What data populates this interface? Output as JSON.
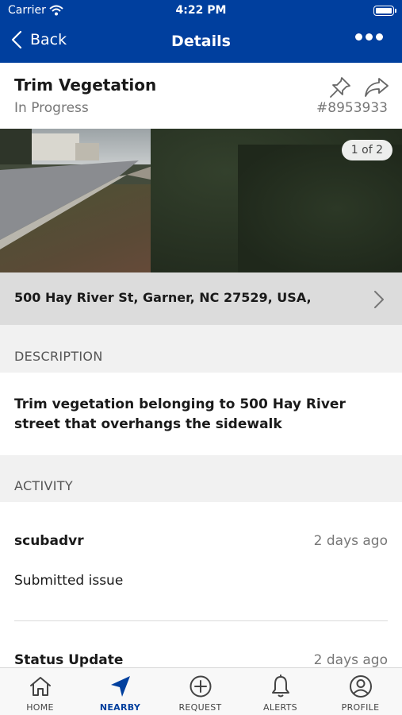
{
  "status_bar": {
    "carrier": "Carrier",
    "time": "4:22 PM"
  },
  "nav": {
    "back_label": "Back",
    "title": "Details"
  },
  "issue": {
    "title": "Trim Vegetation",
    "status": "In Progress",
    "id": "#8953933",
    "photo_counter": "1 of 2",
    "address": "500 Hay River St, Garner, NC 27529, USA,"
  },
  "description": {
    "header": "DESCRIPTION",
    "text": "Trim vegetation belonging to 500 Hay River street that overhangs the sidewalk"
  },
  "activity": {
    "header": "ACTIVITY",
    "items": [
      {
        "user": "scubadvr",
        "when": "2 days ago",
        "message": "Submitted issue"
      },
      {
        "user": "Status Update",
        "when": "2 days ago",
        "message": ""
      }
    ]
  },
  "tabs": [
    {
      "label": "HOME",
      "icon": "home-icon"
    },
    {
      "label": "NEARBY",
      "icon": "location-arrow-icon",
      "active": true
    },
    {
      "label": "REQUEST",
      "icon": "plus-circle-icon"
    },
    {
      "label": "ALERTS",
      "icon": "bell-icon"
    },
    {
      "label": "PROFILE",
      "icon": "user-circle-icon"
    }
  ],
  "colors": {
    "brand": "#003f9e",
    "section_bg": "#f1f1f1",
    "address_bg": "#dcdcdc"
  }
}
